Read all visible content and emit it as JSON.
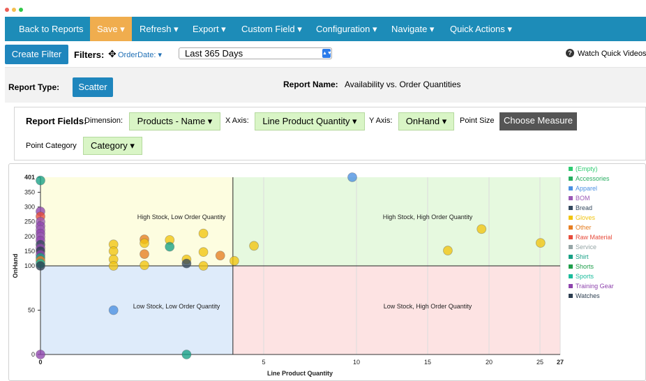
{
  "navbar": {
    "items": [
      "Back to Reports",
      "Save ▾",
      "Refresh ▾",
      "Export ▾",
      "Custom Field ▾",
      "Configuration ▾",
      "Navigate ▾",
      "Quick Actions ▾"
    ]
  },
  "filterbar": {
    "create_filter": "Create Filter",
    "filters_label": "Filters:",
    "orderdate": "OrderDate: ▾",
    "range_value": "Last 365 Days",
    "watch": "Watch Quick Videos"
  },
  "report": {
    "type_label": "Report Type:",
    "type_value": "Scatter",
    "name_label": "Report Name:",
    "name_value": "Availability vs. Order Quantities"
  },
  "fields": {
    "label": "Report Fields:",
    "dimension_label": "Dimension:",
    "dimension_value": "Products - Name ▾",
    "x_label": "X Axis:",
    "x_value": "Line Product Quantity ▾",
    "y_label": "Y Axis:",
    "y_value": "OnHand ▾",
    "size_label": "Point Size",
    "size_value": "Choose Measure",
    "category_label": "Point Category",
    "category_value": "Category ▾"
  },
  "colors": {
    "nav": "#1d8cb8",
    "save": "#f0ad4e",
    "button": "#1f86bd",
    "chip": "#d9f5c6"
  },
  "chart_data": {
    "type": "scatter",
    "xlabel": "Line Product Quantity",
    "ylabel": "OnHand",
    "x_ticks": [
      "0",
      "5",
      "10",
      "15",
      "20",
      "25",
      "27"
    ],
    "y_ticks": [
      "0",
      "50",
      "100",
      "150",
      "200",
      "250",
      "300",
      "350",
      "401"
    ],
    "quadrants": [
      {
        "label": "High Stock, Low Order Quantity",
        "color": "#fdfde0"
      },
      {
        "label": "High Stock, High Order Quantity",
        "color": "#e6f9df"
      },
      {
        "label": "Low Stock, Low Order Quantity",
        "color": "#deebfa"
      },
      {
        "label": "Low Stock, High Order Quantity",
        "color": "#fde3e3"
      }
    ],
    "legend": [
      {
        "name": "(Empty)",
        "color": "#2ecc71"
      },
      {
        "name": "Accessories",
        "color": "#27ae60"
      },
      {
        "name": "Apparel",
        "color": "#4a90e2"
      },
      {
        "name": "BOM",
        "color": "#9b59b6"
      },
      {
        "name": "Bread",
        "color": "#34495e"
      },
      {
        "name": "Gloves",
        "color": "#f1c40f"
      },
      {
        "name": "Other",
        "color": "#e67e22"
      },
      {
        "name": "Raw Material",
        "color": "#e74c3c"
      },
      {
        "name": "Service",
        "color": "#95a5a6"
      },
      {
        "name": "Shirt",
        "color": "#16a085"
      },
      {
        "name": "Shorts",
        "color": "#1e9e4a"
      },
      {
        "name": "Sports",
        "color": "#1abc9c"
      },
      {
        "name": "Training Gear",
        "color": "#8e44ad"
      },
      {
        "name": "Watches",
        "color": "#2c3e50"
      }
    ],
    "points": [
      {
        "x": 0,
        "y": 390,
        "cat": "Shirt"
      },
      {
        "x": 0,
        "y": 285,
        "cat": "Training Gear"
      },
      {
        "x": 0,
        "y": 268,
        "cat": "Raw Material"
      },
      {
        "x": 0,
        "y": 250,
        "cat": "BOM"
      },
      {
        "x": 0,
        "y": 235,
        "cat": "Training Gear"
      },
      {
        "x": 0,
        "y": 222,
        "cat": "BOM"
      },
      {
        "x": 0,
        "y": 210,
        "cat": "Training Gear"
      },
      {
        "x": 0,
        "y": 198,
        "cat": "BOM"
      },
      {
        "x": 0,
        "y": 186,
        "cat": "Training Gear"
      },
      {
        "x": 0,
        "y": 172,
        "cat": "Bread"
      },
      {
        "x": 0,
        "y": 160,
        "cat": "Training Gear"
      },
      {
        "x": 0,
        "y": 150,
        "cat": "Watches"
      },
      {
        "x": 0,
        "y": 138,
        "cat": "Training Gear"
      },
      {
        "x": 0,
        "y": 128,
        "cat": "Shirt"
      },
      {
        "x": 0,
        "y": 118,
        "cat": "Other"
      },
      {
        "x": 0,
        "y": 108,
        "cat": "Sports"
      },
      {
        "x": 0,
        "y": 100,
        "cat": "Watches"
      },
      {
        "x": 0,
        "y": 0,
        "cat": "Training Gear"
      },
      {
        "x": 2.6,
        "y": 173,
        "cat": "Gloves"
      },
      {
        "x": 2.6,
        "y": 150,
        "cat": "Gloves"
      },
      {
        "x": 2.6,
        "y": 122,
        "cat": "Gloves"
      },
      {
        "x": 2.6,
        "y": 100,
        "cat": "Gloves"
      },
      {
        "x": 2.6,
        "y": 50,
        "cat": "Apparel"
      },
      {
        "x": 3.7,
        "y": 190,
        "cat": "Other"
      },
      {
        "x": 3.7,
        "y": 177,
        "cat": "Gloves"
      },
      {
        "x": 3.7,
        "y": 140,
        "cat": "Other"
      },
      {
        "x": 3.7,
        "y": 102,
        "cat": "Gloves"
      },
      {
        "x": 4.6,
        "y": 188,
        "cat": "Gloves"
      },
      {
        "x": 4.6,
        "y": 165,
        "cat": "Shirt"
      },
      {
        "x": 5.2,
        "y": 122,
        "cat": "Gloves"
      },
      {
        "x": 5.2,
        "y": 108,
        "cat": "Bread"
      },
      {
        "x": 5.2,
        "y": 0,
        "cat": "Shirt"
      },
      {
        "x": 5.8,
        "y": 210,
        "cat": "Gloves"
      },
      {
        "x": 5.8,
        "y": 147,
        "cat": "Gloves"
      },
      {
        "x": 5.8,
        "y": 100,
        "cat": "Gloves"
      },
      {
        "x": 6.4,
        "y": 135,
        "cat": "Other"
      },
      {
        "x": 6.9,
        "y": 117,
        "cat": "Gloves"
      },
      {
        "x": 7.6,
        "y": 168,
        "cat": "Gloves"
      },
      {
        "x": 11.1,
        "y": 401,
        "cat": "Apparel"
      },
      {
        "x": 14.5,
        "y": 152,
        "cat": "Gloves"
      },
      {
        "x": 15.7,
        "y": 225,
        "cat": "Gloves"
      },
      {
        "x": 17.8,
        "y": 178,
        "cat": "Gloves"
      }
    ]
  }
}
